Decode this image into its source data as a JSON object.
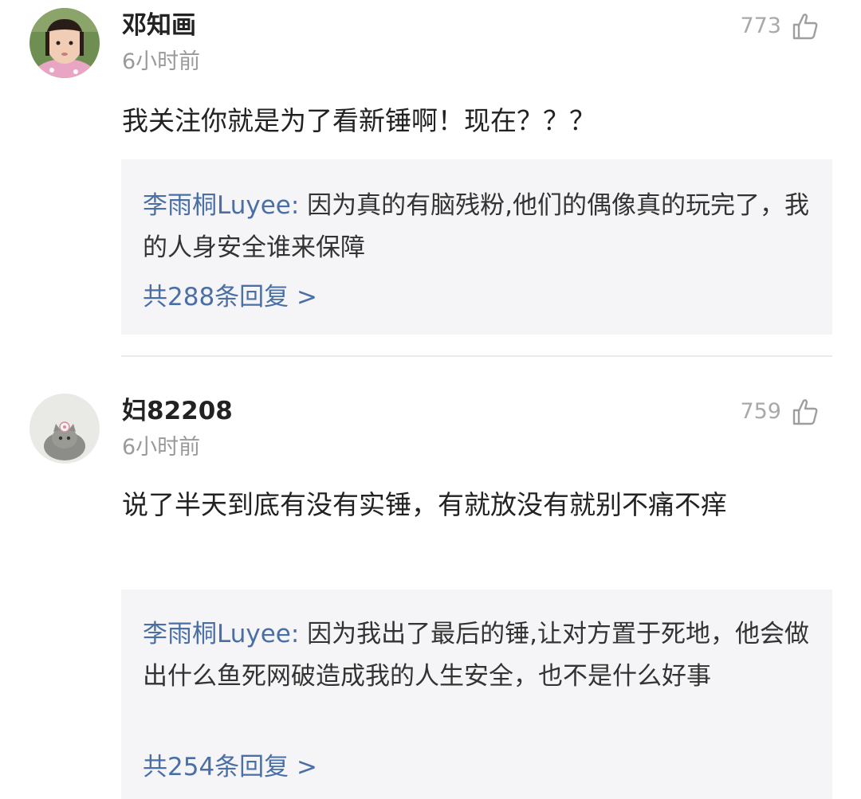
{
  "comments": [
    {
      "username": "邓知画",
      "time": "6小时前",
      "likes": "773",
      "text": "我关注你就是为了看新锤啊！现在？？？",
      "reply": {
        "author": "李雨桐Luyee:",
        "text": " 因为真的有脑残粉,他们的偶像真的玩完了，我的人身安全谁来保障",
        "count_label": "共288条回复 >"
      },
      "avatar": "avatar-girl"
    },
    {
      "username": "妇82208",
      "time": "6小时前",
      "likes": "759",
      "text": "说了半天到底有没有实锤，有就放没有就别不痛不痒",
      "reply": {
        "author": "李雨桐Luyee:",
        "text": " 因为我出了最后的锤,让对方置于死地，他会做出什么鱼死网破造成我的人生安全，也不是什么好事",
        "count_label": "共254条回复 >"
      },
      "avatar": "avatar-cat"
    }
  ],
  "icons": {
    "like": "thumbs-up-icon"
  },
  "colors": {
    "reply_link": "#4a6fa5",
    "reply_bg": "#f5f5f7",
    "muted": "#9a9a9a"
  }
}
